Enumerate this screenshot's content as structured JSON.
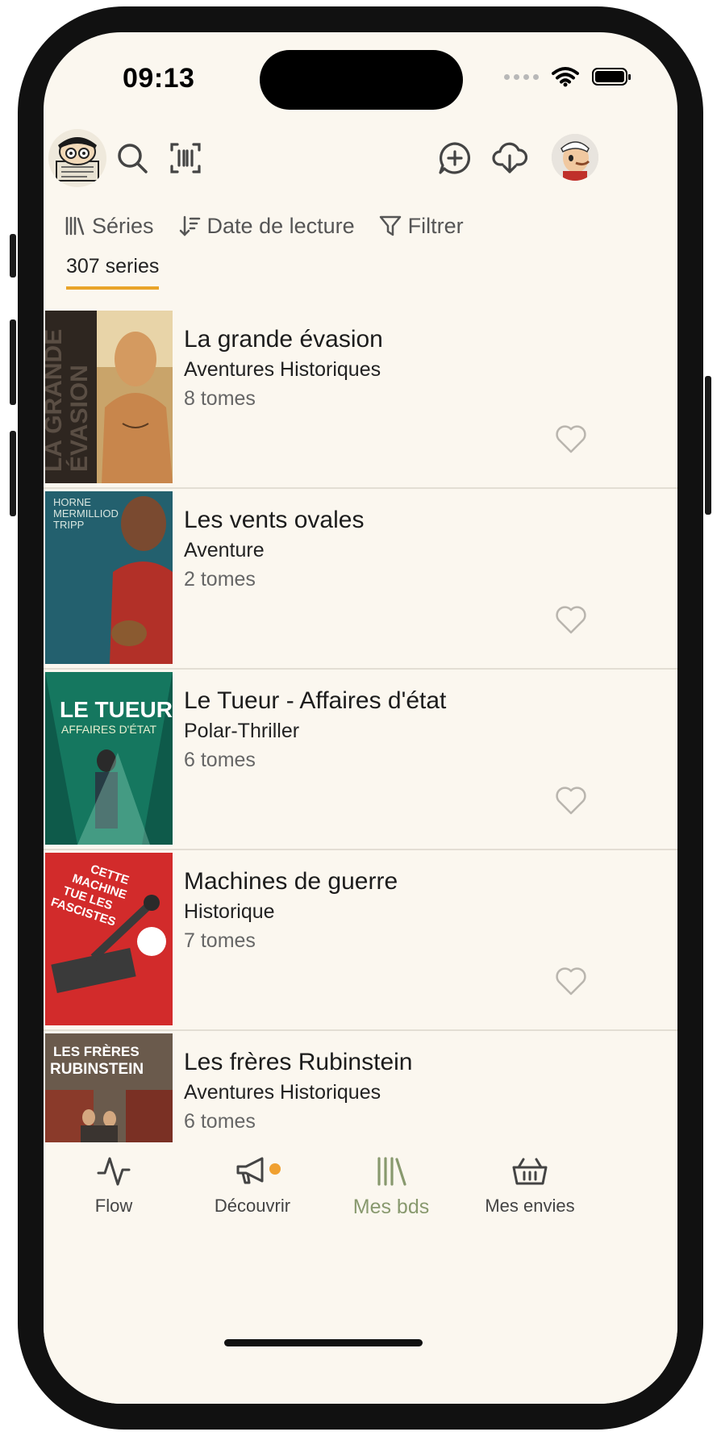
{
  "status": {
    "time": "09:13"
  },
  "toolbar": {
    "logo": "bd-reader-logo",
    "search": "search-icon",
    "barcode": "barcode-scan-icon",
    "add_comment": "chat-plus-icon",
    "download": "cloud-download-icon",
    "avatar": "user-avatar"
  },
  "filters": {
    "view_label": "Séries",
    "sort_label": "Date de lecture",
    "filter_label": "Filtrer"
  },
  "summary": {
    "series_count": "307 series",
    "accent_color": "#e9a42a"
  },
  "series": [
    {
      "title": "La grande évasion",
      "genre": "Aventures Historiques",
      "tomes": "8 tomes",
      "cover_text": "LA GRANDE ÉVASION"
    },
    {
      "title": "Les vents ovales",
      "genre": "Aventure",
      "tomes": "2 tomes",
      "cover_text": "HORNE MERMILLIOD TRIPP"
    },
    {
      "title": "Le Tueur - Affaires d'état",
      "genre": "Polar-Thriller",
      "tomes": "6 tomes",
      "cover_text": "LE TUEUR"
    },
    {
      "title": "Machines de guerre",
      "genre": "Historique",
      "tomes": "7 tomes",
      "cover_text": "CETTE MACHINE TUE LES FASCISTES"
    },
    {
      "title": "Les frères Rubinstein",
      "genre": "Aventures Historiques",
      "tomes": "6 tomes",
      "cover_text": "LES FRÈRES RUBINSTEIN"
    }
  ],
  "tabs": [
    {
      "label": "Flow",
      "icon": "activity-pulse-icon"
    },
    {
      "label": "Découvrir",
      "icon": "megaphone-icon",
      "badge_color": "#f0a030"
    },
    {
      "label": "Mes bds",
      "icon": "library-icon",
      "active_color": "#88996e"
    },
    {
      "label": "Mes envies",
      "icon": "basket-icon"
    }
  ]
}
